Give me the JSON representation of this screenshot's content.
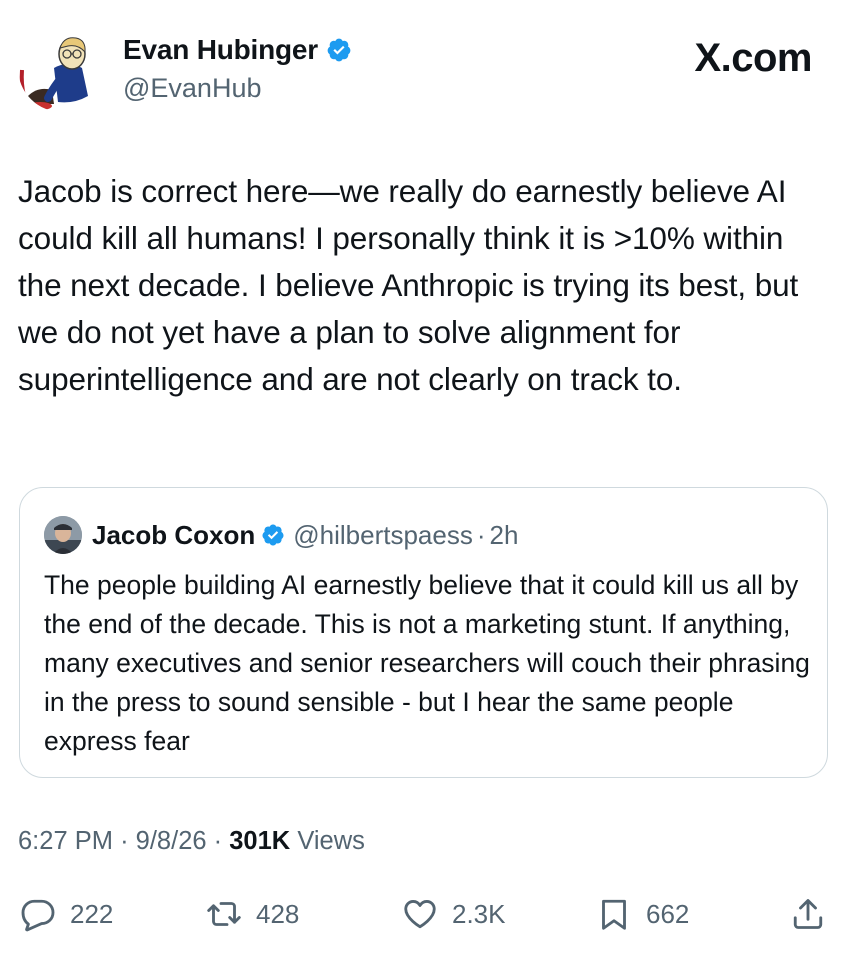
{
  "author": {
    "name": "Evan Hubinger",
    "handle": "@EvanHub"
  },
  "brand": "X.com",
  "tweet": {
    "text": "Jacob is correct here—we really do earnestly believe AI could kill all humans! I personally think it is >10% within the next decade. I believe Anthropic is trying its best, but we do not yet have a plan to solve alignment for superintelligence and are not clearly on track to."
  },
  "quote": {
    "name": "Jacob Coxon",
    "handle": "@hilbertspaess",
    "separator": "·",
    "time": "2h",
    "text": "The people building AI earnestly believe that it could kill us all by the end of the decade. This is not a marketing stunt. If anything, many executives and senior researchers will couch their phrasing in the press to sound sensible - but I hear the same people express fear"
  },
  "meta": {
    "time": "6:27 PM",
    "date": "9/8/26",
    "separator": "·",
    "views_count": "301K",
    "views_label": "Views"
  },
  "actions": {
    "replies": "222",
    "reposts": "428",
    "likes": "2.3K",
    "bookmarks": "662"
  },
  "colors": {
    "verified_blue": "#1d9bf0",
    "secondary_text": "#536471",
    "primary_text": "#0f1419",
    "border": "#cfd9de"
  },
  "icons": [
    "verified-badge-icon",
    "reply-icon",
    "repost-icon",
    "like-icon",
    "bookmark-icon",
    "share-icon"
  ]
}
